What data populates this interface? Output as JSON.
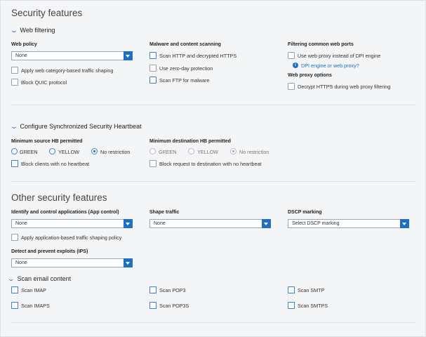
{
  "title": "Security features",
  "web_filtering": {
    "header": "Web filtering",
    "web_policy_label": "Web policy",
    "web_policy_value": "None",
    "apply_shaping": "Apply web category-based traffic shaping",
    "block_quic": "Block QUIC protocol",
    "malware_label": "Malware and content scanning",
    "scan_http": "Scan HTTP and decrypted HTTPS",
    "zero_day": "Use zero-day protection",
    "scan_ftp": "Scan FTP for malware",
    "ports_label": "Filtering common web ports",
    "use_proxy": "Use web proxy instead of DPI engine",
    "dpi_link": "DPI engine or web proxy?",
    "proxy_options_label": "Web proxy options",
    "decrypt_https": "Decrypt HTTPS during web proxy filtering"
  },
  "heartbeat": {
    "header": "Configure Synchronized Security Heartbeat",
    "min_source_label": "Minimum source HB permitted",
    "min_dest_label": "Minimum destination HB permitted",
    "green": "GREEN",
    "yellow": "YELLOW",
    "no_restriction": "No restriction",
    "block_clients": "Block clients with no heartbeat",
    "block_request": "Block request to destination with no heartbeat"
  },
  "other": {
    "title": "Other security features",
    "app_control_label": "Identify and control applications (App control)",
    "app_control_value": "None",
    "apply_app_shaping": "Apply application-based traffic shaping policy",
    "shape_traffic_label": "Shape traffic",
    "shape_traffic_value": "None",
    "dscp_label": "DSCP marking",
    "dscp_placeholder": "Select DSCP marking",
    "ips_label": "Detect and prevent exploits (IPS)",
    "ips_value": "None"
  },
  "email": {
    "header": "Scan email content",
    "scan_imap": "Scan IMAP",
    "scan_imaps": "Scan IMAPS",
    "scan_pop3": "Scan POP3",
    "scan_pop3s": "Scan POP3S",
    "scan_smtp": "Scan SMTP",
    "scan_smtps": "Scan SMTPS"
  },
  "icons": {
    "chevron": "chevron-down-icon",
    "info": "info-icon",
    "dropdown": "dropdown-arrow-icon"
  },
  "colors": {
    "accent": "#1f6fc2",
    "background": "#f4f5f7"
  }
}
